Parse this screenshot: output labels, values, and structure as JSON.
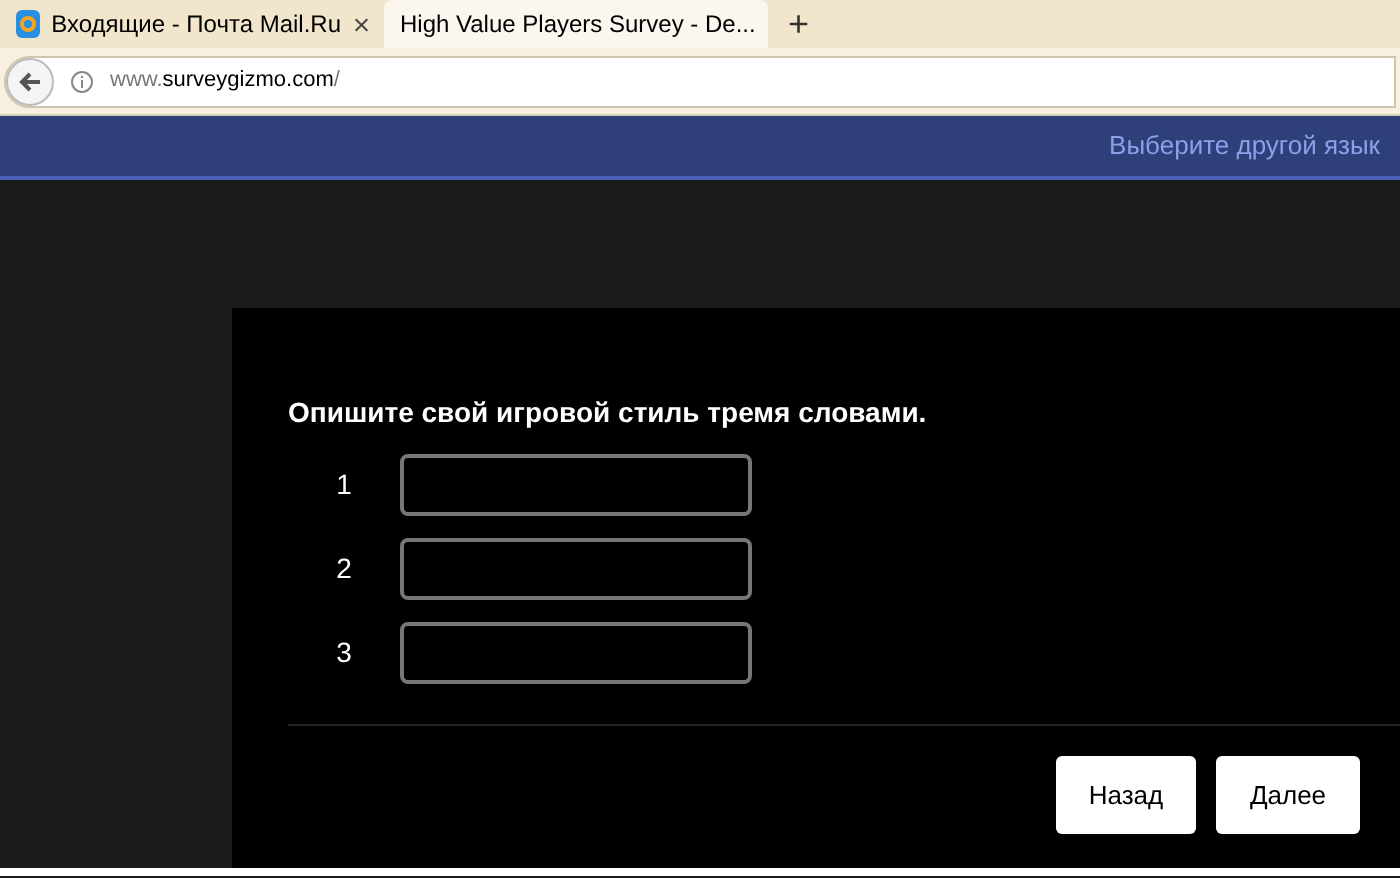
{
  "browser": {
    "tabs": [
      {
        "title": "Входящие - Почта Mail.Ru",
        "selected": false
      },
      {
        "title": "High Value Players Survey - De...",
        "selected": true
      }
    ],
    "new_tab": "+",
    "url_host": "www.",
    "url_domain": "surveygizmo.com",
    "url_path": "/"
  },
  "header": {
    "language_link": "Выберите другой язык"
  },
  "question": {
    "text": "Опишите свой игровой стиль тремя словами.",
    "fields": [
      {
        "number": "1"
      },
      {
        "number": "2"
      },
      {
        "number": "3"
      }
    ]
  },
  "buttons": [
    {
      "label": "Назад"
    },
    {
      "label": "Далее"
    }
  ]
}
